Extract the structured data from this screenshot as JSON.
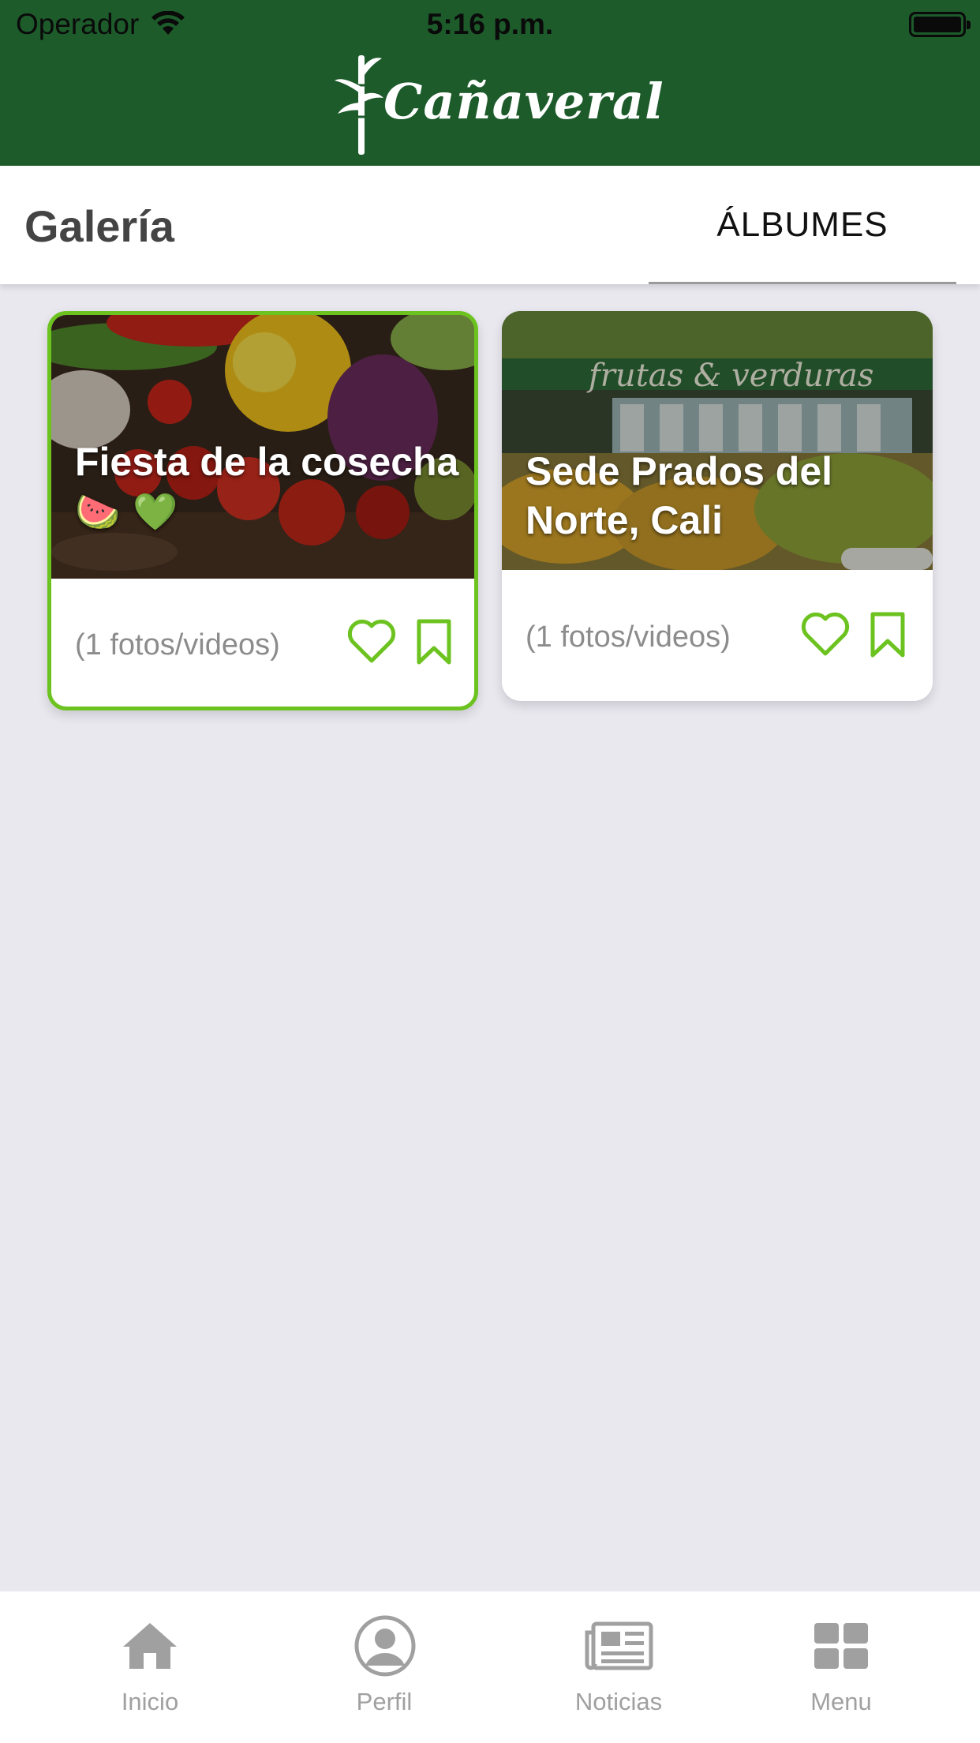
{
  "status_bar": {
    "carrier": "Operador",
    "time": "5:16 p.m."
  },
  "header": {
    "brand": "Cañaveral"
  },
  "gallery": {
    "title": "Galería",
    "tab_label": "ÁLBUMES"
  },
  "albums": [
    {
      "title": "Fiesta de la cosecha",
      "emoji": "🍉 💚",
      "count": "(1 fotos/videos)",
      "selected": true
    },
    {
      "title": "Sede Prados del Norte, Cali",
      "emoji": "",
      "count": "(1 fotos/videos)",
      "selected": false
    }
  ],
  "bottom_nav": {
    "items": [
      {
        "label": "Inicio",
        "icon": "home-icon"
      },
      {
        "label": "Perfil",
        "icon": "profile-icon"
      },
      {
        "label": "Noticias",
        "icon": "newspaper-icon"
      },
      {
        "label": "Menu",
        "icon": "grid-icon"
      }
    ]
  },
  "colors": {
    "header_green": "#1d5b2b",
    "accent_green": "#6cc320",
    "background": "#e9e8ef",
    "nav_gray": "#a0a0a0"
  }
}
